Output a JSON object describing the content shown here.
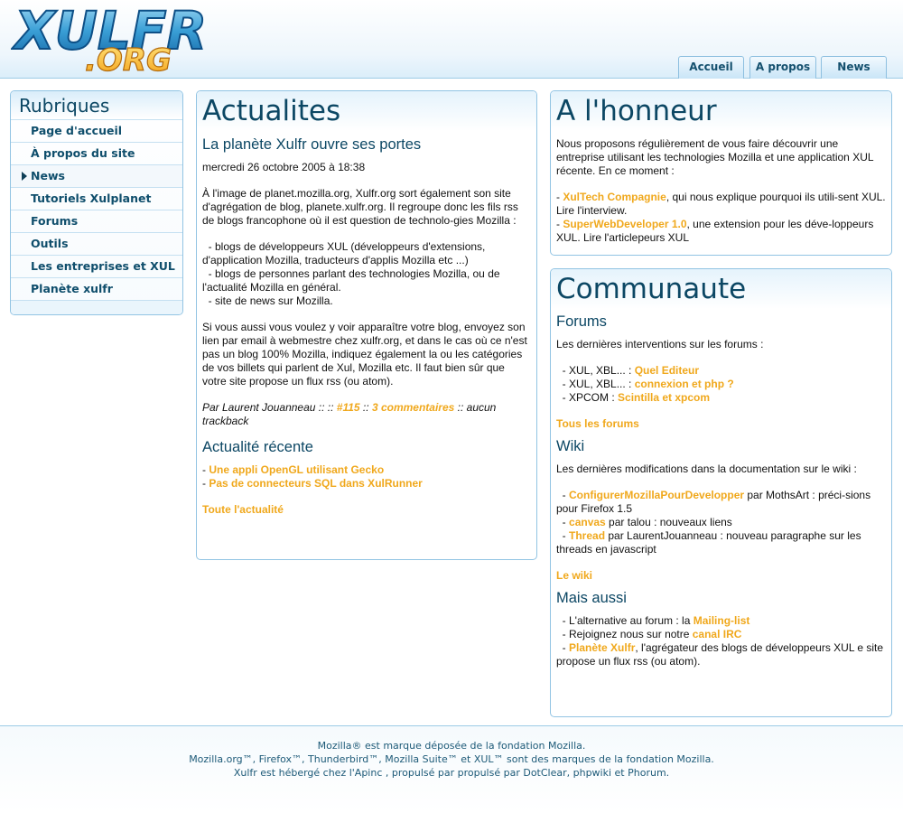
{
  "header": {
    "logo_text": "XULFR",
    "logo_sub": ".ORG",
    "tabs": [
      "Accueil",
      "A propos",
      "News"
    ]
  },
  "sidebar": {
    "title": "Rubriques",
    "items": [
      {
        "label": "Page d'accueil"
      },
      {
        "label": "À propos du site"
      },
      {
        "label": "News"
      },
      {
        "label": "Tutoriels Xulplanet"
      },
      {
        "label": "Forums"
      },
      {
        "label": "Outils"
      },
      {
        "label": "Les entreprises et XUL"
      },
      {
        "label": "Planète xulfr"
      }
    ]
  },
  "actualites": {
    "title": "Actualites",
    "post_title": "La planète Xulfr ouvre ses portes",
    "date": "mercredi 26 octobre 2005 à 18:38",
    "p1": "À l'image de planet.mozilla.org, Xulfr.org sort également son site d'agrégation de blog, planete.xulfr.org. Il regroupe donc les fils rss de blogs francophone où il est question de technolo-gies Mozilla :",
    "bullets": "  - blogs de développeurs XUL (développeurs d'extensions, d'application Mozilla, traducteurs d'applis Mozilla etc ...)\n  - blogs de personnes parlant des technologies Mozilla, ou de l'actualité Mozilla en général.\n  - site de news sur Mozilla.",
    "p2": "Si vous aussi vous voulez y voir apparaître votre blog, envoyez son lien par email à webmestre chez xulfr.org, et dans le cas où ce n'est pas un blog 100% Mozilla, indiquez également la ou les catégories de vos billets qui parlent de Xul, Mozilla etc. Il faut bien sûr que votre site propose un flux rss (ou atom).",
    "byline_pre": "Par Laurent Jouanneau :: :: ",
    "byline_link1": "#115",
    "byline_mid": " :: ",
    "byline_link2": "3 commentaires",
    "byline_post": " :: aucun trackback",
    "recent_title": "Actualité récente",
    "recent": [
      "Une appli OpenGL utilisant Gecko",
      "Pas de connecteurs SQL dans XulRunner"
    ],
    "all_link": "Toute l'actualité"
  },
  "honneur": {
    "title": "A l'honneur",
    "intro": "Nous proposons régulièrement de vous faire découvrir une entreprise utilisant les technologies Mozilla et une application XUL récente. En ce moment :",
    "item1_link": "XulTech Compagnie",
    "item1_text": ", qui nous explique pourquoi ils utili-sent XUL. Lire l'interview.",
    "item2_link": "SuperWebDeveloper 1.0",
    "item2_text": ", une extension pour les déve-loppeurs XUL. Lire l'articlepeurs XUL"
  },
  "communaute": {
    "title": "Communaute",
    "forums_title": "Forums",
    "forums_intro": "Les dernières interventions sur les forums :",
    "forums": [
      {
        "prefix": "  - XUL, XBL... : ",
        "link": "Quel Editeur"
      },
      {
        "prefix": "  - XUL, XBL... : ",
        "link": "connexion et php ?"
      },
      {
        "prefix": "  - XPCOM : ",
        "link": "Scintilla et xpcom"
      }
    ],
    "forums_all": "Tous les forums",
    "wiki_title": "Wiki",
    "wiki_intro": "Les dernières modifications dans la documentation sur le wiki :",
    "wiki": [
      {
        "prefix": "  - ",
        "link": "ConfigurerMozillaPourDevelopper",
        "text": " par MothsArt : préci-sions pour Firefox 1.5"
      },
      {
        "prefix": "  - ",
        "link": "canvas",
        "text": " par talou : nouveaux liens"
      },
      {
        "prefix": "  - ",
        "link": "Thread",
        "text": " par LaurentJouanneau : nouveau paragraphe sur les threads en javascript"
      }
    ],
    "wiki_all": "Le wiki",
    "aussi_title": "Mais aussi",
    "aussi": [
      {
        "prefix": "  - L'alternative au forum : la ",
        "link": "Mailing-list",
        "text": ""
      },
      {
        "prefix": "  - Rejoignez nous sur notre ",
        "link": "canal IRC",
        "text": ""
      },
      {
        "prefix": "  - ",
        "link": "Planète Xulfr",
        "text": ", l'agrégateur des blogs de développeurs XUL e site propose un flux rss (ou atom)."
      }
    ]
  },
  "footer": {
    "line1": "Mozilla® est marque déposée de la fondation Mozilla.",
    "line2": "Mozilla.org™, Firefox™, Thunderbird™, Mozilla Suite™ et XUL™ sont des marques de la fondation Mozilla.",
    "line3": "Xulfr est hébergé chez l'Apinc , propulsé par propulsé par DotClear, phpwiki et Phorum."
  }
}
